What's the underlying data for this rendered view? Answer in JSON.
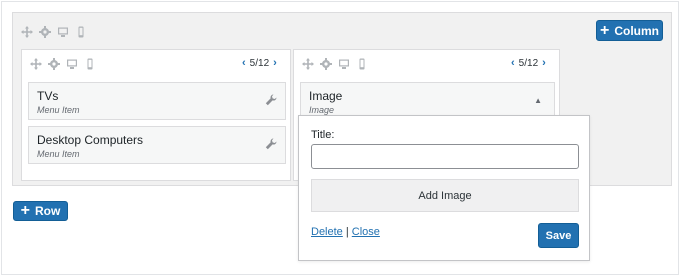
{
  "toolbar": {
    "add_column_label": "Column",
    "add_row_label": "Row"
  },
  "columns": [
    {
      "size": "5/12",
      "items": [
        {
          "title": "TVs",
          "type": "Menu Item"
        },
        {
          "title": "Desktop Computers",
          "type": "Menu Item"
        }
      ]
    },
    {
      "size": "5/12",
      "items": [
        {
          "title": "Image",
          "type": "Image"
        }
      ]
    }
  ],
  "popover": {
    "title_label": "Title:",
    "title_value": "",
    "add_image_label": "Add Image",
    "delete_label": "Delete",
    "separator": "|",
    "close_label": "Close",
    "save_label": "Save"
  },
  "colors": {
    "accent": "#2271b1",
    "panel_bg": "#f1f1f1"
  },
  "icons": [
    "move-icon",
    "gear-icon",
    "desktop-icon",
    "mobile-icon",
    "wrench-icon",
    "chevron-left-icon",
    "chevron-right-icon",
    "caret-up-icon"
  ]
}
